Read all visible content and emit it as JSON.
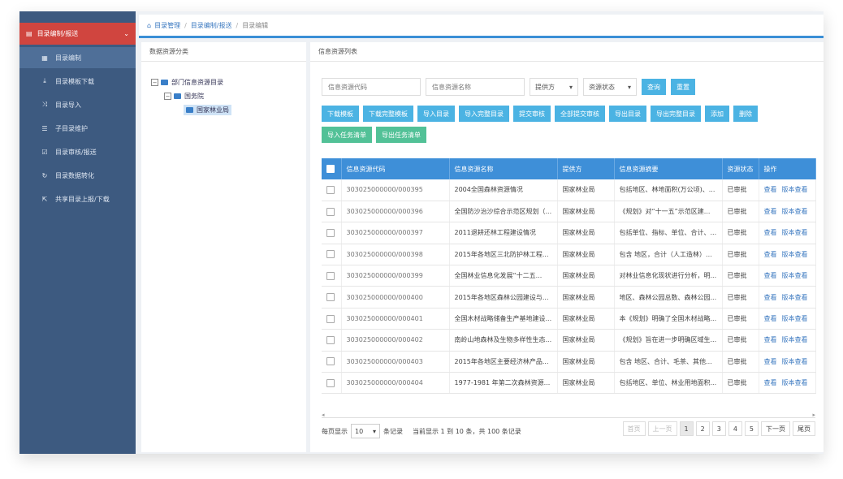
{
  "breadcrumb": {
    "home": "目录管理",
    "mid": "目录编制/报送",
    "current": "目录编辑"
  },
  "sidebar": {
    "header": "目录编制/报送",
    "items": [
      {
        "label": "目录编制",
        "icon": "grid-icon"
      },
      {
        "label": "目录模板下载",
        "icon": "download-icon"
      },
      {
        "label": "目录导入",
        "icon": "shuffle-icon"
      },
      {
        "label": "子目录维护",
        "icon": "list-icon"
      },
      {
        "label": "目录审核/报送",
        "icon": "check-icon"
      },
      {
        "label": "目录数据转化",
        "icon": "refresh-icon"
      },
      {
        "label": "共享目录上报/下载",
        "icon": "share-icon"
      }
    ]
  },
  "left_panel": {
    "title": "数据资源分类",
    "tree": [
      {
        "label": "部门信息资源目录",
        "toggle": "−"
      },
      {
        "label": "国务院",
        "toggle": "−"
      },
      {
        "label": "国家林业局",
        "toggle": ""
      }
    ]
  },
  "right_panel": {
    "title": "信息资源列表",
    "filters": {
      "code_placeholder": "信息资源代码",
      "name_placeholder": "信息资源名称",
      "provider": "提供方",
      "status": "资源状态",
      "search": "查询",
      "reset": "重置"
    },
    "toolbar": [
      {
        "label": "下载模板",
        "color": "blue"
      },
      {
        "label": "下载完整模板",
        "color": "blue"
      },
      {
        "label": "导入目录",
        "color": "blue"
      },
      {
        "label": "导入完整目录",
        "color": "blue"
      },
      {
        "label": "提交审核",
        "color": "blue"
      },
      {
        "label": "全部提交审核",
        "color": "blue"
      },
      {
        "label": "导出目录",
        "color": "blue"
      },
      {
        "label": "导出完整目录",
        "color": "blue"
      },
      {
        "label": "添加",
        "color": "blue"
      },
      {
        "label": "删除",
        "color": "blue"
      },
      {
        "label": "导入任务清单",
        "color": "green"
      },
      {
        "label": "导出任务清单",
        "color": "green"
      }
    ],
    "table": {
      "headers": [
        "信息资源代码",
        "信息资源名称",
        "提供方",
        "信息资源摘要",
        "资源状态",
        "操作"
      ],
      "rows": [
        {
          "code": "303025000000/000395",
          "name": "2004全国森林资源情况",
          "provider": "国家林业局",
          "summary": "包括地区、林地面积(万公顷)、...",
          "status": "已审批"
        },
        {
          "code": "303025000000/000396",
          "name": "全国防沙治沙综合示范区规划（...",
          "provider": "国家林业局",
          "summary": "《规划》对“十一五”示范区建...",
          "status": "已审批"
        },
        {
          "code": "303025000000/000397",
          "name": "2011退耕还林工程建设情况",
          "provider": "国家林业局",
          "summary": "包括单位、指标、单位、合计、...",
          "status": "已审批"
        },
        {
          "code": "303025000000/000398",
          "name": "2015年各地区三北防护林工程...",
          "provider": "国家林业局",
          "summary": "包含 地区，合计（人工造林）...",
          "status": "已审批"
        },
        {
          "code": "303025000000/000399",
          "name": "全国林业信息化发展“十二五...",
          "provider": "国家林业局",
          "summary": "对林业信息化现状进行分析，明...",
          "status": "已审批"
        },
        {
          "code": "303025000000/000400",
          "name": "2015年各地区森林公园建设与...",
          "provider": "国家林业局",
          "summary": "地区、森林公园总数、森林公园...",
          "status": "已审批"
        },
        {
          "code": "303025000000/000401",
          "name": "全国木材战略储备生产基地建设...",
          "provider": "国家林业局",
          "summary": "本《规划》明确了全国木材战略...",
          "status": "已审批"
        },
        {
          "code": "303025000000/000402",
          "name": "南岭山地森林及生物多样性生态...",
          "provider": "国家林业局",
          "summary": "《规划》旨在进一步明确区域生...",
          "status": "已审批"
        },
        {
          "code": "303025000000/000403",
          "name": "2015年各地区主要经济林产品...",
          "provider": "国家林业局",
          "summary": "包含 地区、合计、毛茶、其他...",
          "status": "已审批"
        },
        {
          "code": "303025000000/000404",
          "name": "1977-1981 年第二次森林资源...",
          "provider": "国家林业局",
          "summary": "包括地区、单位、林业用地面积...",
          "status": "已审批"
        }
      ],
      "op_view": "查看",
      "op_version": "版本查看"
    },
    "footer": {
      "show_prefix": "每页显示",
      "page_size": "10",
      "show_suffix": "条记录",
      "summary": "当前显示 1 到 10 条，共 100 条记录"
    },
    "pagination": [
      "首页",
      "上一页",
      "1",
      "2",
      "3",
      "4",
      "5",
      "下一页",
      "尾页"
    ]
  }
}
